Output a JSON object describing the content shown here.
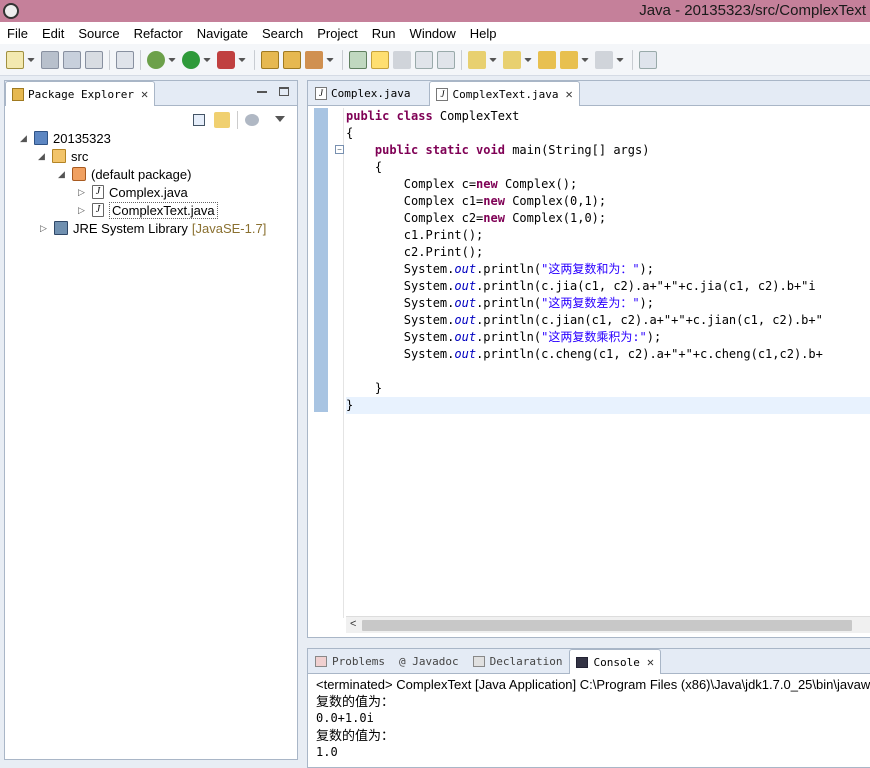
{
  "window": {
    "title": "Java - 20135323/src/ComplexText"
  },
  "menu": [
    "File",
    "Edit",
    "Source",
    "Refactor",
    "Navigate",
    "Search",
    "Project",
    "Run",
    "Window",
    "Help"
  ],
  "package_explorer": {
    "tab_label": "Package Explorer",
    "project": "20135323",
    "src": "src",
    "package": "(default package)",
    "files": [
      "Complex.java",
      "ComplexText.java"
    ],
    "jre_label": "JRE System Library",
    "jre_version": "[JavaSE-1.7]"
  },
  "editor": {
    "tabs": [
      {
        "label": "Complex.java",
        "selected": false
      },
      {
        "label": "ComplexText.java",
        "selected": true
      }
    ],
    "lines": {
      "l1_kw": "public class ",
      "l1_rest": "ComplexText",
      "l2": "{",
      "l3_kw": "public static void ",
      "l3_rest": "main(String[] args)",
      "l4": "{",
      "l5a": "Complex c=",
      "l5kw": "new",
      "l5b": " Complex();",
      "l6a": "Complex c1=",
      "l6kw": "new",
      "l6b": " Complex(0,1);",
      "l7a": "Complex c2=",
      "l7kw": "new",
      "l7b": " Complex(1,0);",
      "l8": "c1.Print();",
      "l9": "c2.Print();",
      "l10str": "\"这两复数和为：\"",
      "l11a": "(",
      "l11rest": "(c.jia(c1, c2).a+\"+\"+c.jia(c1, c2).b+\"i",
      "l12str": "\"这两复数差为：\"",
      "l13rest": "(c.jian(c1, c2).a+\"+\"+c.jian(c1, c2).b+\"",
      "l14str": "\"这两复数乘积为:\"",
      "l15rest": "(c.cheng(c1, c2).a+\"+\"+c.cheng(c1,c2).b+",
      "sys": "System.",
      "out": "out",
      "println": ".println",
      "end": ");",
      "close_inner": "}",
      "close_outer": "}"
    }
  },
  "console_view": {
    "tabs": [
      "Problems",
      "@ Javadoc",
      "Declaration",
      "Console"
    ],
    "header": "<terminated> ComplexText [Java Application] C:\\Program Files (x86)\\Java\\jdk1.7.0_25\\bin\\javaw",
    "output": [
      "复数的值为：",
      "0.0+1.0i",
      "复数的值为：",
      "1.0"
    ]
  }
}
